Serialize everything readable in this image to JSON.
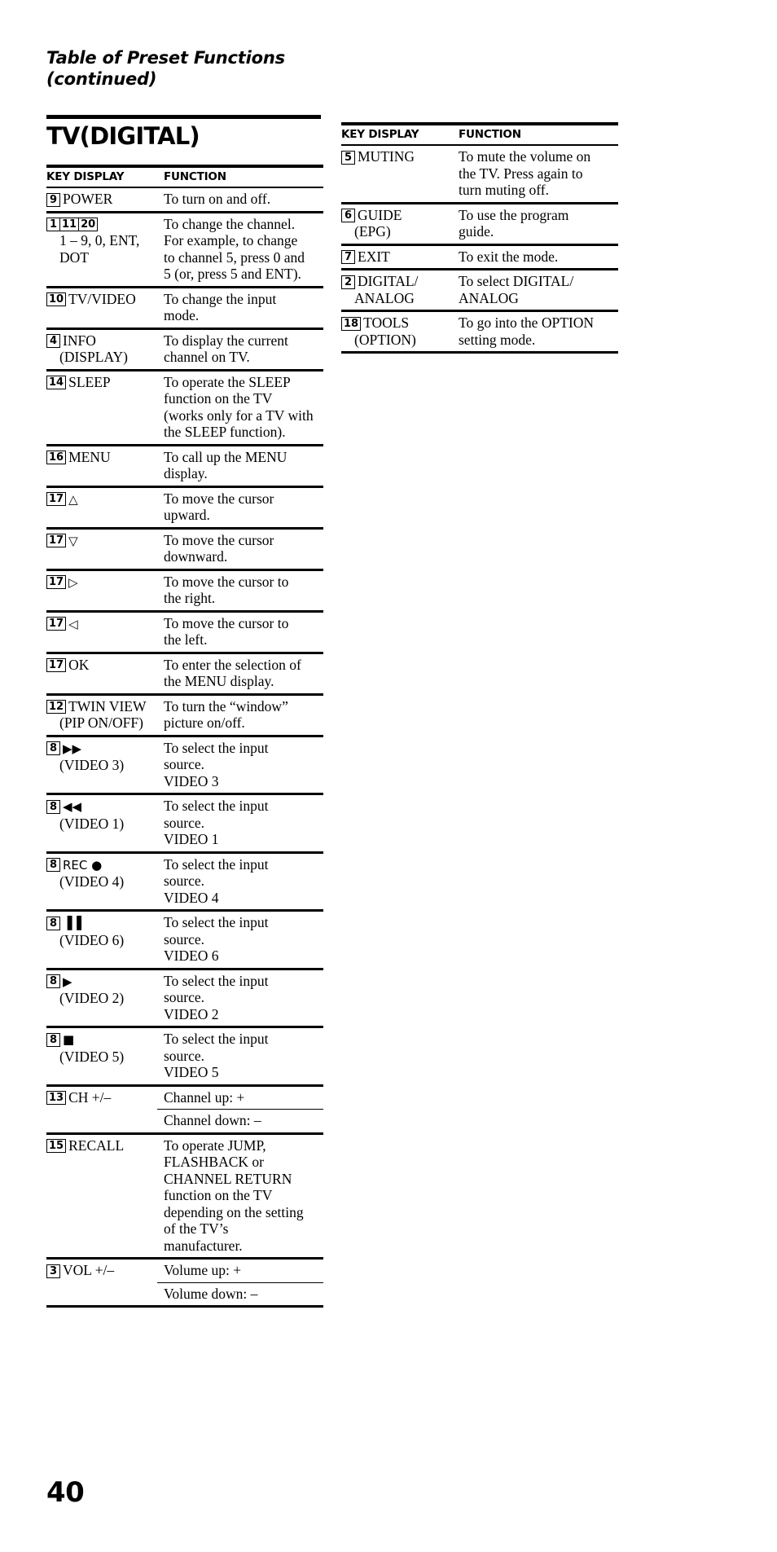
{
  "running_head": {
    "line1": "Table of Preset Functions",
    "line2": "(continued)"
  },
  "section": {
    "title": "TV(DIGITAL)"
  },
  "table_headers": {
    "key": "KEY DISPLAY",
    "function": "FUNCTION"
  },
  "left_table": {
    "rows": [
      {
        "keys": [
          "9"
        ],
        "key_label": "POWER",
        "key_sub": "",
        "fn_lines": [
          "To turn on and off."
        ]
      },
      {
        "keys": [
          "1",
          "11",
          "20"
        ],
        "key_label": "",
        "key_sub_lines": [
          "1 – 9, 0, ENT,",
          "DOT"
        ],
        "fn_lines": [
          "To change the channel.",
          "For example, to change",
          "to channel 5, press 0 and",
          "5 (or, press 5 and ENT)."
        ]
      },
      {
        "keys": [
          "10"
        ],
        "key_label": "TV/VIDEO",
        "key_sub": "",
        "fn_lines": [
          "To change the input",
          "mode."
        ]
      },
      {
        "keys": [
          "4"
        ],
        "key_label": "INFO",
        "key_sub": "(DISPLAY)",
        "fn_lines": [
          "To display the current",
          "channel on TV."
        ]
      },
      {
        "keys": [
          "14"
        ],
        "key_label": "SLEEP",
        "key_sub": "",
        "fn_lines": [
          "To operate the SLEEP",
          "function on the TV",
          "(works only for a TV with",
          "the SLEEP function)."
        ]
      },
      {
        "keys": [
          "16"
        ],
        "key_label": "MENU",
        "key_sub": "",
        "fn_lines": [
          "To call up the MENU",
          "display."
        ]
      },
      {
        "keys": [
          "17"
        ],
        "key_label": "△",
        "key_icon": "cursor-up-icon",
        "key_sub": "",
        "fn_lines": [
          "To move the cursor",
          "upward."
        ]
      },
      {
        "keys": [
          "17"
        ],
        "key_label": "▽",
        "key_icon": "cursor-down-icon",
        "key_sub": "",
        "fn_lines": [
          "To move the cursor",
          "downward."
        ]
      },
      {
        "keys": [
          "17"
        ],
        "key_label": "▷",
        "key_icon": "cursor-right-icon",
        "key_sub": "",
        "fn_lines": [
          "To move the cursor to",
          "the right."
        ]
      },
      {
        "keys": [
          "17"
        ],
        "key_label": "◁",
        "key_icon": "cursor-left-icon",
        "key_sub": "",
        "fn_lines": [
          "To move the cursor to",
          "the left."
        ]
      },
      {
        "keys": [
          "17"
        ],
        "key_label": "OK",
        "key_sub": "",
        "fn_lines": [
          "To enter the selection of",
          "the MENU display."
        ]
      },
      {
        "keys": [
          "12"
        ],
        "key_label": "TWIN VIEW",
        "key_sub": "(PIP ON/OFF)",
        "fn_lines": [
          "To turn the “window”",
          "picture on/off."
        ]
      },
      {
        "keys": [
          "8"
        ],
        "key_label": "▶▶",
        "key_icon": "fast-forward-icon",
        "key_sub": "(VIDEO 3)",
        "fn_lines": [
          "To select the input",
          "source.",
          "VIDEO 3"
        ]
      },
      {
        "keys": [
          "8"
        ],
        "key_label": "◀◀",
        "key_icon": "rewind-icon",
        "key_sub": "(VIDEO 1)",
        "fn_lines": [
          "To select the input",
          "source.",
          "VIDEO 1"
        ]
      },
      {
        "keys": [
          "8"
        ],
        "key_label": "REC ●",
        "key_icon": "record-icon",
        "key_sub": "(VIDEO 4)",
        "fn_lines": [
          "To select the input",
          "source.",
          "VIDEO 4"
        ]
      },
      {
        "keys": [
          "8"
        ],
        "key_label": "▐▐",
        "key_icon": "pause-icon",
        "key_sub": "(VIDEO 6)",
        "fn_lines": [
          "To select the input",
          "source.",
          "VIDEO 6"
        ]
      },
      {
        "keys": [
          "8"
        ],
        "key_label": "▶",
        "key_icon": "play-icon",
        "key_sub": "(VIDEO 2)",
        "fn_lines": [
          "To select the input",
          "source.",
          "VIDEO 2"
        ]
      },
      {
        "keys": [
          "8"
        ],
        "key_label": "■",
        "key_icon": "stop-icon",
        "key_sub": "(VIDEO 5)",
        "fn_lines": [
          "To select the input",
          "source.",
          "VIDEO 5"
        ]
      },
      {
        "keys": [
          "13"
        ],
        "key_label": "CH +/–",
        "key_sub": "",
        "fn_lines": [
          "Channel up: +"
        ],
        "fn_lines_2": [
          "Channel down: –"
        ]
      },
      {
        "keys": [
          "15"
        ],
        "key_label": "RECALL",
        "key_sub": "",
        "fn_lines": [
          "To operate JUMP,",
          "FLASHBACK or",
          "CHANNEL RETURN",
          "function on the TV",
          "depending on the setting",
          "of the TV’s",
          "manufacturer."
        ]
      },
      {
        "keys": [
          "3"
        ],
        "key_label": "VOL +/–",
        "key_sub": "",
        "fn_lines": [
          "Volume up: +"
        ],
        "fn_lines_2": [
          "Volume down: –"
        ]
      }
    ]
  },
  "right_table": {
    "rows": [
      {
        "keys": [
          "5"
        ],
        "key_label": "MUTING",
        "key_sub": "",
        "fn_lines": [
          "To mute the volume on",
          "the TV.  Press again to",
          "turn muting off."
        ]
      },
      {
        "keys": [
          "6"
        ],
        "key_label": "GUIDE",
        "key_sub": "(EPG)",
        "fn_lines": [
          "To use the program",
          "guide."
        ]
      },
      {
        "keys": [
          "7"
        ],
        "key_label": "EXIT",
        "key_sub": "",
        "fn_lines": [
          "To exit the mode."
        ]
      },
      {
        "keys": [
          "2"
        ],
        "key_label": "DIGITAL/",
        "key_sub": "ANALOG",
        "fn_lines": [
          "To select DIGITAL/",
          "ANALOG"
        ]
      },
      {
        "keys": [
          "18"
        ],
        "key_label": "TOOLS",
        "key_sub": "(OPTION)",
        "fn_lines": [
          "To go into the OPTION",
          "setting mode."
        ]
      }
    ]
  },
  "folio": {
    "page_number": "40"
  }
}
